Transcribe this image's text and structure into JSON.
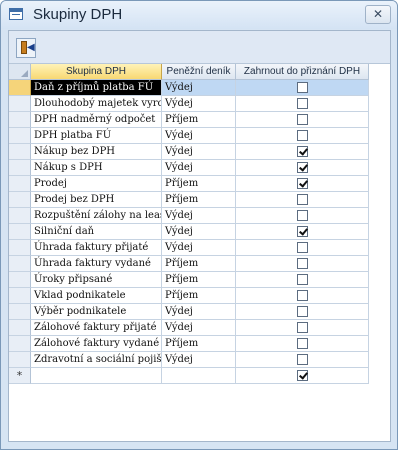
{
  "window": {
    "title": "Skupiny DPH",
    "close_symbol": "✕"
  },
  "toolbar": {
    "exit_icon": "exit-door-icon"
  },
  "grid": {
    "columns": [
      "Skupina DPH",
      "Peněžní deník",
      "Zahrnout do přiznání DPH"
    ],
    "rows": [
      {
        "name": "Daň z příjmů platba FÚ",
        "ledger": "Výdej",
        "include": false
      },
      {
        "name": "Dlouhodobý majetek vyro",
        "ledger": "Výdej",
        "include": false
      },
      {
        "name": "DPH nadměrný odpočet",
        "ledger": "Příjem",
        "include": false
      },
      {
        "name": "DPH platba FÚ",
        "ledger": "Výdej",
        "include": false
      },
      {
        "name": "Nákup bez DPH",
        "ledger": "Výdej",
        "include": true
      },
      {
        "name": "Nákup s DPH",
        "ledger": "Výdej",
        "include": true
      },
      {
        "name": "Prodej",
        "ledger": "Příjem",
        "include": true
      },
      {
        "name": "Prodej bez DPH",
        "ledger": "Příjem",
        "include": false
      },
      {
        "name": "Rozpuštění zálohy na leas",
        "ledger": "Výdej",
        "include": false
      },
      {
        "name": "Silniční daň",
        "ledger": "Výdej",
        "include": true
      },
      {
        "name": "Úhrada faktury přijaté",
        "ledger": "Výdej",
        "include": false
      },
      {
        "name": "Úhrada faktury vydané",
        "ledger": "Příjem",
        "include": false
      },
      {
        "name": "Úroky připsané",
        "ledger": "Příjem",
        "include": false
      },
      {
        "name": "Vklad podnikatele",
        "ledger": "Příjem",
        "include": false
      },
      {
        "name": "Výběr podnikatele",
        "ledger": "Výdej",
        "include": false
      },
      {
        "name": "Zálohové faktury přijaté",
        "ledger": "Výdej",
        "include": false
      },
      {
        "name": "Zálohové faktury vydané",
        "ledger": "Příjem",
        "include": false
      },
      {
        "name": "Zdravotní a sociální pojiště",
        "ledger": "Výdej",
        "include": false
      }
    ],
    "new_row": {
      "marker": "*",
      "name": "",
      "ledger": "",
      "include": true
    }
  }
}
